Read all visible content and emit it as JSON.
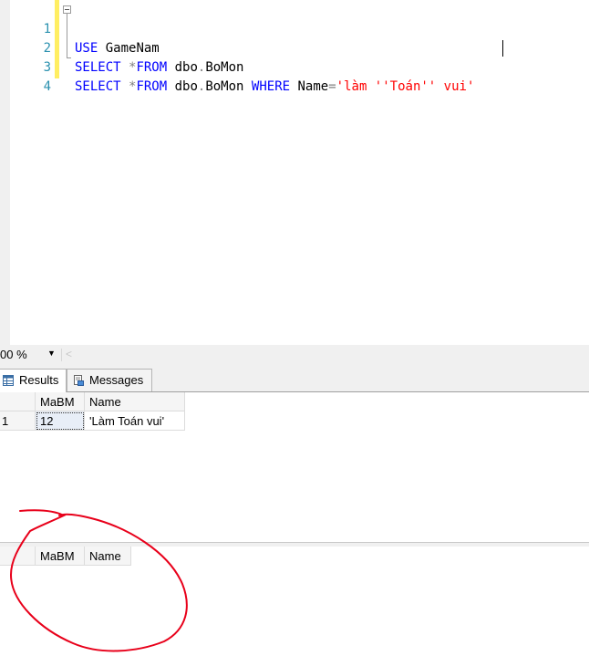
{
  "editor": {
    "lines": [
      {
        "num": "1",
        "tokens": [
          {
            "t": "USE",
            "c": "kw"
          },
          {
            "t": " GameNam",
            "c": "txt"
          }
        ]
      },
      {
        "num": "2",
        "tokens": [
          {
            "t": "SELECT",
            "c": "kw"
          },
          {
            "t": " ",
            "c": "txt"
          },
          {
            "t": "*",
            "c": "op"
          },
          {
            "t": "FROM",
            "c": "kw"
          },
          {
            "t": " dbo",
            "c": "txt"
          },
          {
            "t": ".",
            "c": "op"
          },
          {
            "t": "BoMon",
            "c": "txt"
          }
        ]
      },
      {
        "num": "3",
        "tokens": [
          {
            "t": "SELECT",
            "c": "kw"
          },
          {
            "t": " ",
            "c": "txt"
          },
          {
            "t": "*",
            "c": "op"
          },
          {
            "t": "FROM",
            "c": "kw"
          },
          {
            "t": " dbo",
            "c": "txt"
          },
          {
            "t": ".",
            "c": "op"
          },
          {
            "t": "BoMon ",
            "c": "txt"
          },
          {
            "t": "WHERE",
            "c": "kw"
          },
          {
            "t": " Name",
            "c": "txt"
          },
          {
            "t": "=",
            "c": "op"
          },
          {
            "t": "'làm ''Toán'' vui'",
            "c": "str"
          }
        ]
      },
      {
        "num": "4",
        "tokens": []
      }
    ]
  },
  "zoom": {
    "value": "00 %",
    "dropdown_glyph": "▼",
    "scroll_left_glyph": "<"
  },
  "tabs": {
    "results": "Results",
    "messages": "Messages"
  },
  "grid1": {
    "columns": [
      "MaBM",
      "Name"
    ],
    "rows": [
      {
        "row_num": "1",
        "MaBM": "12",
        "Name": "'Làm Toán vui'"
      }
    ]
  },
  "grid2": {
    "columns": [
      "MaBM",
      "Name"
    ],
    "rows": []
  },
  "colors": {
    "keyword": "#0000ff",
    "string": "#ff0000",
    "line_number": "#2b91af",
    "annotation": "#e8001a"
  }
}
